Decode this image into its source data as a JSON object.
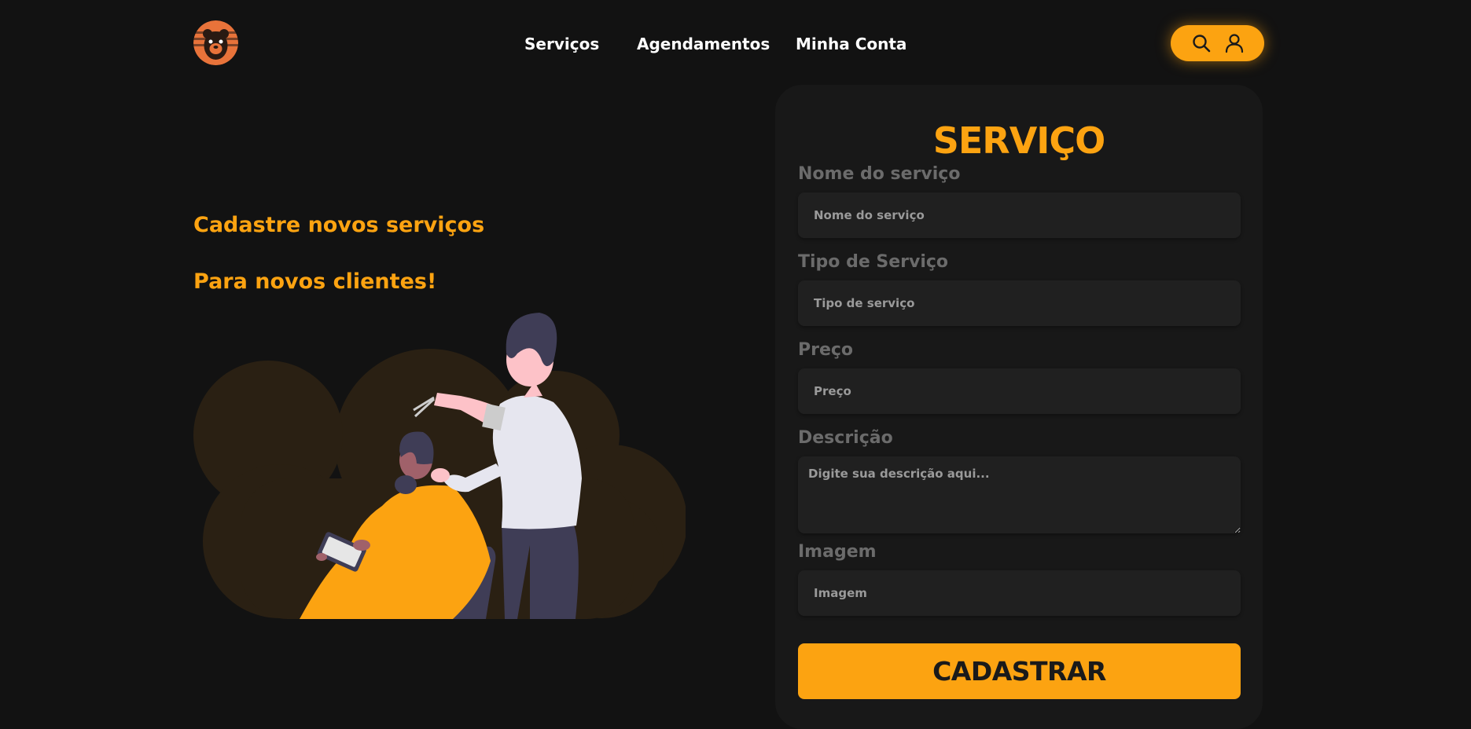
{
  "header": {
    "nav": [
      "Serviços",
      "Agendamentos",
      "Minha Conta"
    ],
    "actions": {
      "search_icon": "search-icon",
      "account_icon": "user-icon"
    },
    "logo_icon": "bear-logo"
  },
  "hero": {
    "line1": "Cadastre novos serviços",
    "line2": "Para novos clientes!",
    "illustration": "barber-illustration"
  },
  "form": {
    "title": "SERVIÇO",
    "fields": [
      {
        "label": "Nome do serviço",
        "placeholder": "Nome do serviço",
        "value": ""
      },
      {
        "label": "Tipo de Serviço",
        "placeholder": "Tipo de serviço",
        "value": ""
      },
      {
        "label": "Preço",
        "placeholder": "Preço",
        "value": ""
      },
      {
        "label": "Descrição",
        "placeholder": "Digite sua descrição aqui...",
        "value": ""
      },
      {
        "label": "Imagem",
        "placeholder": "Imagem",
        "value": ""
      }
    ],
    "submit": "CADASTRAR"
  },
  "colors": {
    "accent": "#fca311",
    "background": "#121212",
    "card": "#181818",
    "input": "#202020"
  }
}
